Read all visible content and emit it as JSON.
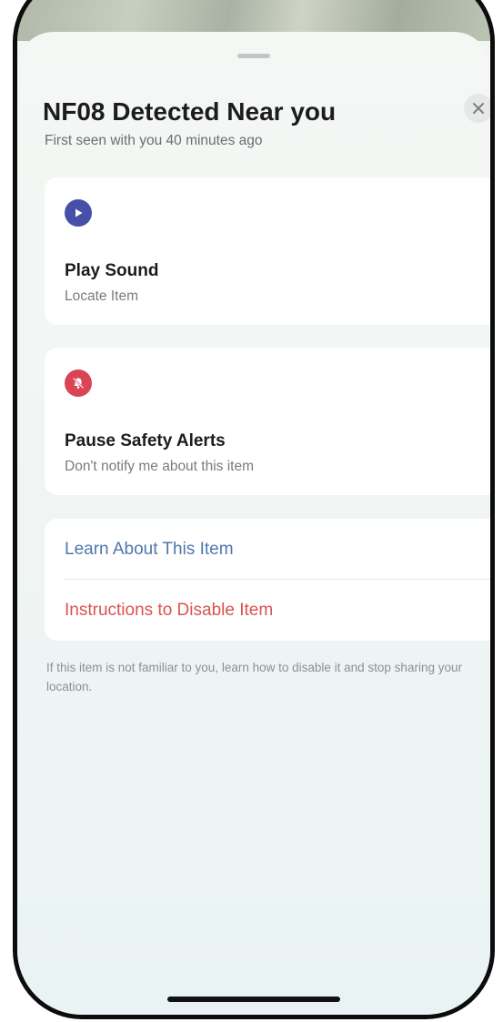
{
  "sheet": {
    "title": "NF08 Detected Near you",
    "subtitle": "First seen with you 40 minutes ago"
  },
  "close": {
    "icon": "close-icon",
    "label": "×"
  },
  "actions": [
    {
      "icon": "play-icon",
      "title": "Play Sound",
      "subtitle": "Locate Item",
      "icon_color": "#4650a8"
    },
    {
      "icon": "bell-slash-icon",
      "title": "Pause Safety Alerts",
      "subtitle": "Don't notify me about this item",
      "icon_color": "#d94555"
    }
  ],
  "links": [
    {
      "label": "Learn About This Item",
      "color": "#4f78ad"
    },
    {
      "label": "Instructions to Disable Item",
      "color": "#d9544f"
    }
  ],
  "footnote": "If this item is not familiar to you, learn how to disable it and stop sharing your location."
}
